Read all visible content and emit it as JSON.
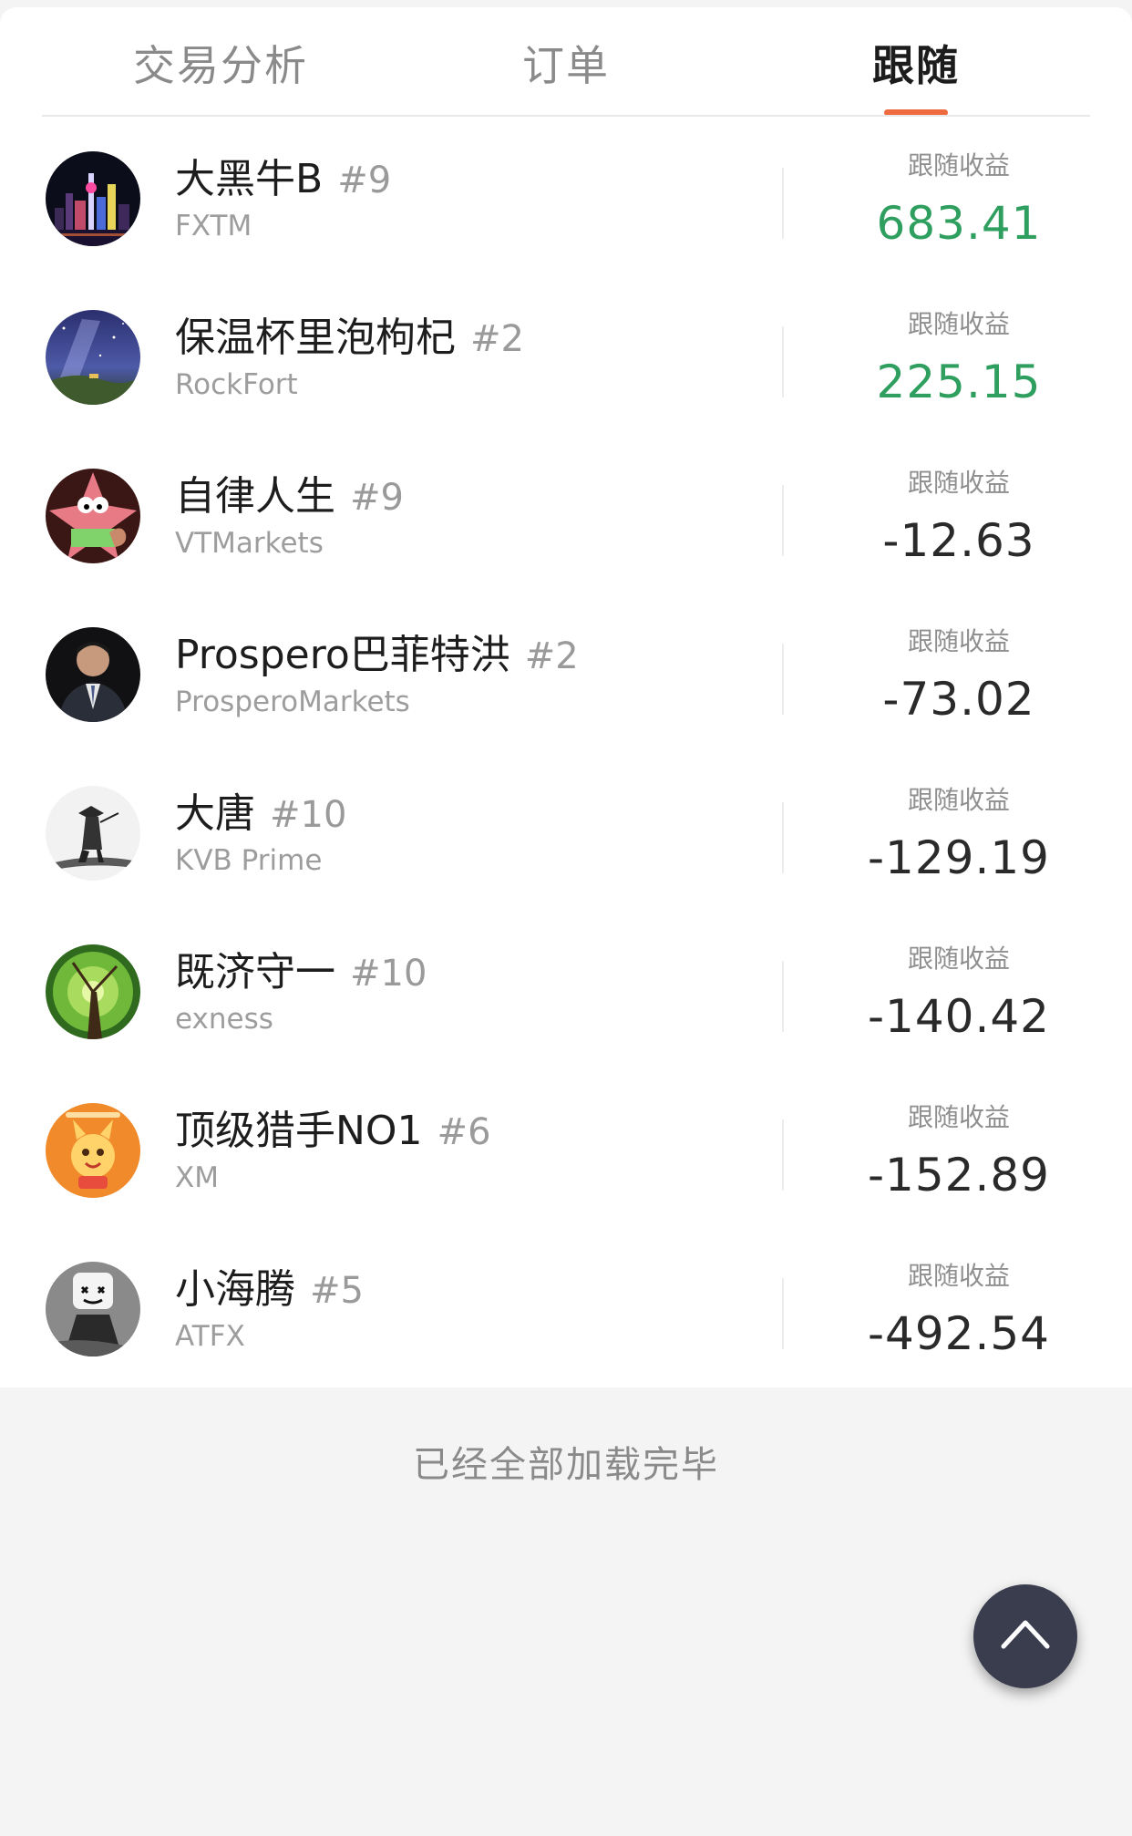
{
  "tabs": [
    {
      "label": "交易分析"
    },
    {
      "label": "订单"
    },
    {
      "label": "跟随"
    }
  ],
  "active_tab": "跟随",
  "rows": [
    {
      "name": "大黑牛B",
      "rank": "#9",
      "broker": "FXTM",
      "profit_label": "跟随收益",
      "profit": "683.41",
      "avatar_icon": "city-night-avatar-icon"
    },
    {
      "name": "保温杯里泡枸杞",
      "rank": "#2",
      "broker": "RockFort",
      "profit_label": "跟随收益",
      "profit": "225.15",
      "avatar_icon": "milky-way-avatar-icon"
    },
    {
      "name": "自律人生",
      "rank": "#9",
      "broker": "VTMarkets",
      "profit_label": "跟随收益",
      "profit": "-12.63",
      "avatar_icon": "cartoon-starfish-avatar-icon"
    },
    {
      "name": "Prospero巴菲特洪",
      "rank": "#2",
      "broker": "ProsperoMarkets",
      "profit_label": "跟随收益",
      "profit": "-73.02",
      "avatar_icon": "man-in-suit-avatar-icon"
    },
    {
      "name": "大唐",
      "rank": "#10",
      "broker": "KVB Prime",
      "profit_label": "跟随收益",
      "profit": "-129.19",
      "avatar_icon": "ink-warrior-avatar-icon"
    },
    {
      "name": "既济守一",
      "rank": "#10",
      "broker": "exness",
      "profit_label": "跟随收益",
      "profit": "-140.42",
      "avatar_icon": "tree-canopy-avatar-icon"
    },
    {
      "name": "顶级猎手NO1",
      "rank": "#6",
      "broker": "XM",
      "profit_label": "跟随收益",
      "profit": "-152.89",
      "avatar_icon": "orange-mascot-avatar-icon"
    },
    {
      "name": "小海腾",
      "rank": "#5",
      "broker": "ATFX",
      "profit_label": "跟随收益",
      "profit": "-492.54",
      "avatar_icon": "marshmello-avatar-icon"
    }
  ],
  "footer": {
    "loaded_text": "已经全部加载完毕"
  },
  "back_to_top_icon": "chevron-up-icon",
  "colors": {
    "accent": "#f06a3f",
    "positive": "#2f9f5f",
    "negative_text": "#2a2a2a",
    "fab": "#3a3d4e"
  }
}
